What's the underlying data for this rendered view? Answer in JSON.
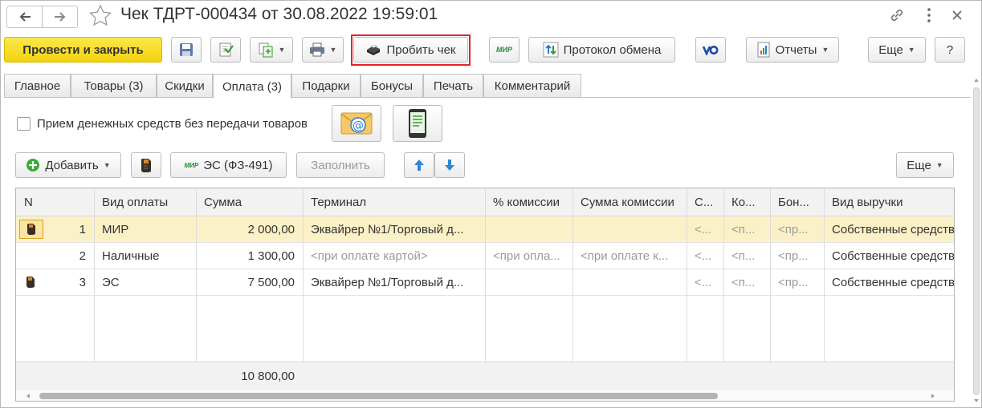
{
  "window": {
    "title": "Чек ТДРТ-000434 от 30.08.2022 19:59:01"
  },
  "toolbar": {
    "post_close": "Провести и закрыть",
    "print_receipt": "Пробить чек",
    "mir_badge": "МИР",
    "exchange_log": "Протокол обмена",
    "reports": "Отчеты",
    "more": "Еще",
    "help": "?"
  },
  "tabs": [
    {
      "label": "Главное"
    },
    {
      "label": "Товары (3)"
    },
    {
      "label": "Скидки"
    },
    {
      "label": "Оплата (3)"
    },
    {
      "label": "Подарки"
    },
    {
      "label": "Бонусы"
    },
    {
      "label": "Печать"
    },
    {
      "label": "Комментарий"
    }
  ],
  "active_tab": "Оплата (3)",
  "payment": {
    "checkbox_label": "Прием денежных средств без передачи товаров",
    "add": "Добавить",
    "es": "ЭС (ФЗ-491)",
    "fill": "Заполнить",
    "more": "Еще",
    "columns": [
      "N",
      "Вид оплаты",
      "Сумма",
      "Терминал",
      "% комиссии",
      "Сумма комиссии",
      "С...",
      "Ко...",
      "Бон...",
      "Вид выручки"
    ],
    "rows": [
      {
        "n": "1",
        "type": "МИР",
        "sum": "2 000,00",
        "terminal": "Эквайрер №1/Торговый д...",
        "pct": "",
        "commission": "",
        "c7": "<...",
        "c8": "<п...",
        "c9": "<пр...",
        "revenue": "Собственные средства"
      },
      {
        "n": "2",
        "type": "Наличные",
        "sum": "1 300,00",
        "terminal": "<при оплате картой>",
        "pct": "<при опла...",
        "commission": "<при оплате к...",
        "c7": "<...",
        "c8": "<п...",
        "c9": "<пр...",
        "revenue": "Собственные средства"
      },
      {
        "n": "3",
        "type": "ЭС",
        "sum": "7 500,00",
        "terminal": "Эквайрер №1/Торговый д...",
        "pct": "",
        "commission": "",
        "c7": "<...",
        "c8": "<п...",
        "c9": "<пр...",
        "revenue": "Собственные средства"
      }
    ],
    "total": "10 800,00"
  },
  "colors": {
    "accent_yellow": "#f5d91a",
    "highlight_red": "#e0232a",
    "selected_row": "#fbf1c6"
  }
}
